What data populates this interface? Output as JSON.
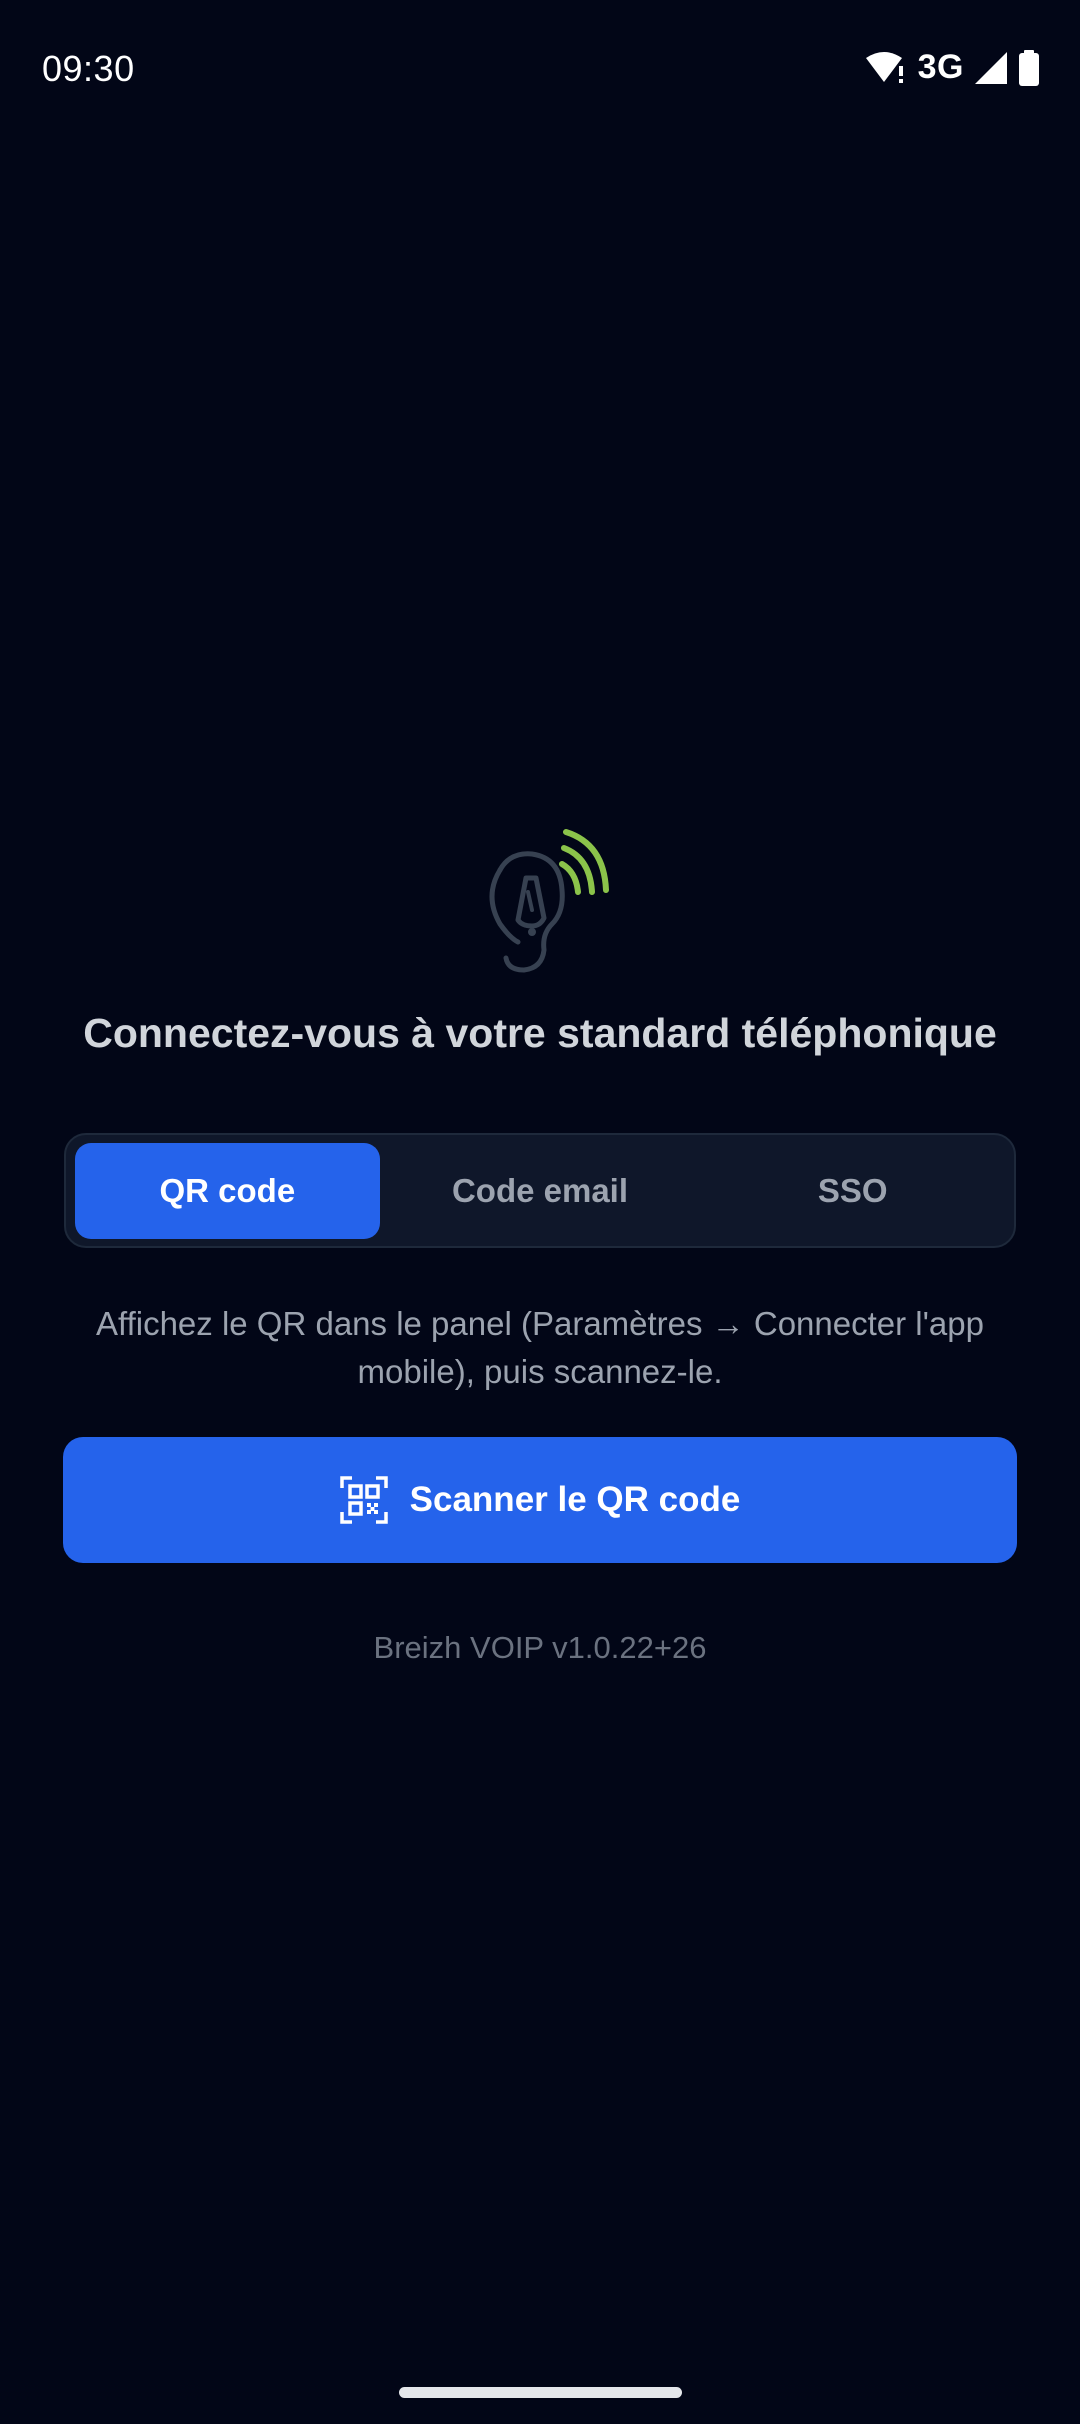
{
  "status_bar": {
    "time": "09:30",
    "network": "3G",
    "icons": [
      "wifi-alert-icon",
      "signal-icon",
      "battery-icon"
    ]
  },
  "logo": {
    "icon": "ear-signal-logo-icon",
    "accent_color": "#8bc34a"
  },
  "title": "Connectez-vous à votre standard téléphonique",
  "tabs": [
    {
      "label": "QR code",
      "active": true
    },
    {
      "label": "Code email",
      "active": false
    },
    {
      "label": "SSO",
      "active": false
    }
  ],
  "instructions": "Affichez le QR dans le panel (Paramètres → Connecter l'app mobile), puis scannez-le.",
  "scan_button": {
    "icon": "qr-scan-icon",
    "label": "Scanner le QR code"
  },
  "version": "Breizh VOIP v1.0.22+26",
  "colors": {
    "background": "#020617",
    "primary": "#2563eb",
    "tab_background": "#0f172a",
    "muted_text": "#9ca3af"
  }
}
